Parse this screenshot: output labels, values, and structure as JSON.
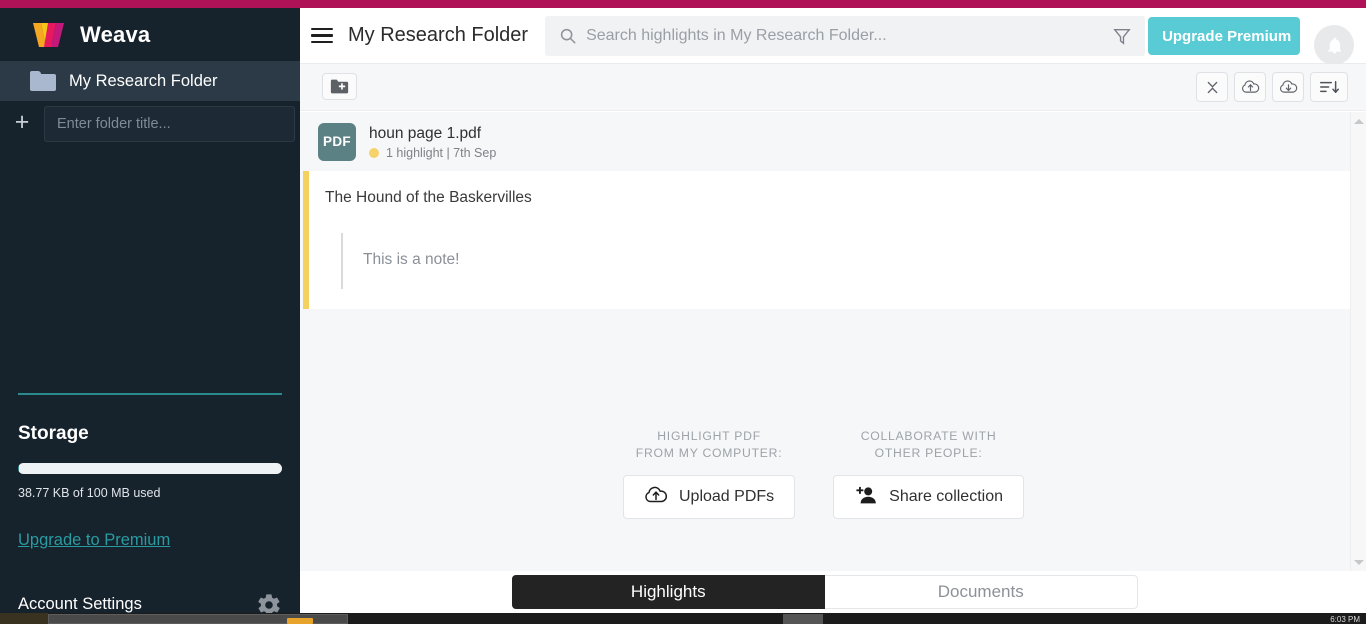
{
  "brand": {
    "name": "Weava",
    "logo_icon": "weava-w-logo"
  },
  "sidebar": {
    "folders": [
      {
        "label": "My Research Folder",
        "icon": "folder-icon",
        "selected": true
      }
    ],
    "new_folder": {
      "add_icon": "plus-icon",
      "placeholder": "Enter folder title...",
      "value": ""
    },
    "storage": {
      "title": "Storage",
      "usage_text": "38.77 KB of 100 MB used",
      "percent_used": 0.04,
      "upgrade_link": "Upgrade to Premium"
    },
    "account": {
      "label": "Account Settings",
      "icon": "gear-icon"
    }
  },
  "header": {
    "menu_icon": "hamburger-icon",
    "title": "My Research Folder",
    "search": {
      "icon": "search-icon",
      "placeholder": "Search highlights in My Research Folder...",
      "value": ""
    },
    "filter_icon": "funnel-filter-icon",
    "upgrade_button": "Upgrade Premium",
    "notification_icon": "bell-icon"
  },
  "toolbar": {
    "new_folder_icon": "folder-plus-icon",
    "collapse_icon": "collapse-all-icon",
    "cloud_upload_icon": "cloud-upload-icon",
    "cloud_download_icon": "cloud-download-icon",
    "sort_icon": "sort-descending-icon"
  },
  "document": {
    "badge": "PDF",
    "name": "houn page 1.pdf",
    "status_dot_color": "#f6d26b",
    "meta": "1 highlight | 7th Sep"
  },
  "highlight": {
    "accent_color": "#f5d25f",
    "text": "The Hound of the Baskervilles",
    "note": "This is a note!"
  },
  "empty_actions": [
    {
      "caption_line1": "Highlight PDF",
      "caption_line2": "from my computer:",
      "button_label": "Upload PDFs",
      "button_icon": "cloud-upload-icon"
    },
    {
      "caption_line1": "Collaborate with",
      "caption_line2": "other people:",
      "button_label": "Share collection",
      "button_icon": "add-person-icon"
    }
  ],
  "tabs": [
    {
      "label": "Highlights",
      "active": true
    },
    {
      "label": "Documents",
      "active": false
    }
  ],
  "colors": {
    "accent_magenta": "#b01258",
    "sidebar_bg": "#16222c",
    "teal": "#2a8b8e",
    "upgrade_button": "#58cbd5",
    "highlight_yellow": "#f5d25f"
  },
  "taskbar": {
    "time": "6:03 PM"
  }
}
